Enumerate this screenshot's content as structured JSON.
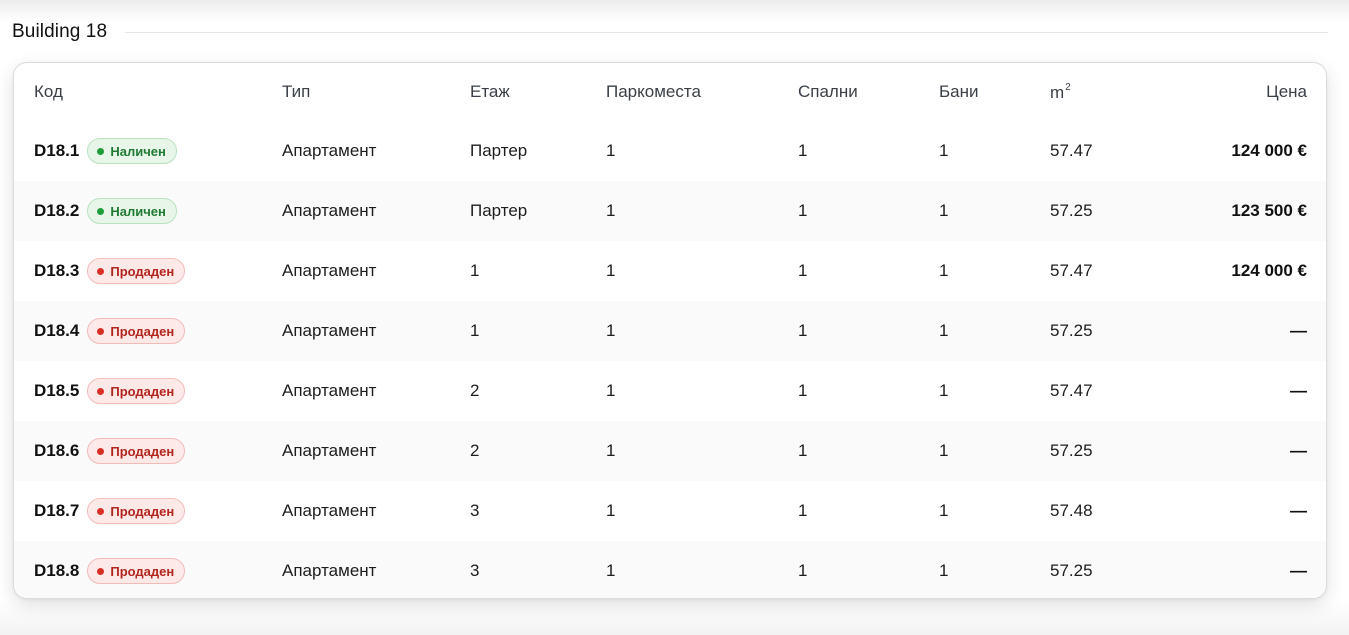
{
  "section": {
    "title": "Building 18"
  },
  "table": {
    "headers": {
      "code": "Код",
      "type": "Тип",
      "floor": "Етаж",
      "parking": "Паркоместа",
      "bedrooms": "Спални",
      "bathrooms": "Бани",
      "area": "m",
      "area_sup": "2",
      "price": "Цена"
    },
    "rows": [
      {
        "code": "D18.1",
        "status": "Наличен",
        "status_type": "available",
        "type": "Апартамент",
        "floor": "Партер",
        "parking": "1",
        "bedrooms": "1",
        "bathrooms": "1",
        "area": "57.47",
        "price": "124 000 €"
      },
      {
        "code": "D18.2",
        "status": "Наличен",
        "status_type": "available",
        "type": "Апартамент",
        "floor": "Партер",
        "parking": "1",
        "bedrooms": "1",
        "bathrooms": "1",
        "area": "57.25",
        "price": "123 500 €"
      },
      {
        "code": "D18.3",
        "status": "Продаден",
        "status_type": "sold",
        "type": "Апартамент",
        "floor": "1",
        "parking": "1",
        "bedrooms": "1",
        "bathrooms": "1",
        "area": "57.47",
        "price": "124 000 €"
      },
      {
        "code": "D18.4",
        "status": "Продаден",
        "status_type": "sold",
        "type": "Апартамент",
        "floor": "1",
        "parking": "1",
        "bedrooms": "1",
        "bathrooms": "1",
        "area": "57.25",
        "price": "—"
      },
      {
        "code": "D18.5",
        "status": "Продаден",
        "status_type": "sold",
        "type": "Апартамент",
        "floor": "2",
        "parking": "1",
        "bedrooms": "1",
        "bathrooms": "1",
        "area": "57.47",
        "price": "—"
      },
      {
        "code": "D18.6",
        "status": "Продаден",
        "status_type": "sold",
        "type": "Апартамент",
        "floor": "2",
        "parking": "1",
        "bedrooms": "1",
        "bathrooms": "1",
        "area": "57.25",
        "price": "—"
      },
      {
        "code": "D18.7",
        "status": "Продаден",
        "status_type": "sold",
        "type": "Апартамент",
        "floor": "3",
        "parking": "1",
        "bedrooms": "1",
        "bathrooms": "1",
        "area": "57.48",
        "price": "—"
      },
      {
        "code": "D18.8",
        "status": "Продаден",
        "status_type": "sold",
        "type": "Апартамент",
        "floor": "3",
        "parking": "1",
        "bedrooms": "1",
        "bathrooms": "1",
        "area": "57.25",
        "price": "—"
      }
    ]
  },
  "colors": {
    "available_text": "#1f7a33",
    "available_bg": "#e8f6ea",
    "sold_text": "#b3261e",
    "sold_bg": "#fde9e8"
  },
  "icons": {
    "status_dot": "status-dot-icon"
  }
}
